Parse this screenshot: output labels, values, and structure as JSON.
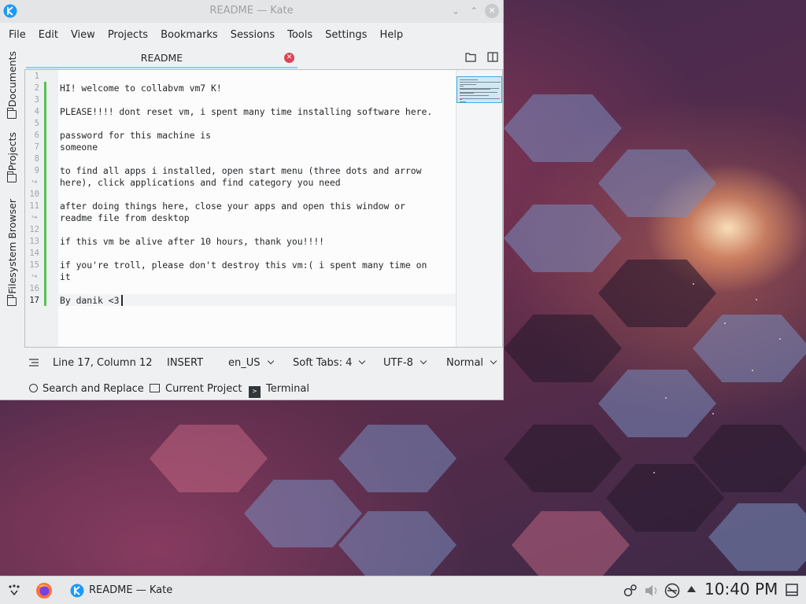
{
  "window": {
    "title": "README — Kate",
    "icon": "kate-icon",
    "controls": [
      "minimize-icon",
      "maximize-icon",
      "close-icon"
    ]
  },
  "menu": [
    "File",
    "Edit",
    "View",
    "Projects",
    "Bookmarks",
    "Sessions",
    "Tools",
    "Settings",
    "Help"
  ],
  "sidebar": {
    "tabs": [
      {
        "label": "Documents",
        "icon": "folder-icon"
      },
      {
        "label": "Projects",
        "icon": "project-icon"
      },
      {
        "label": "Filesystem Browser",
        "icon": "folder-icon"
      }
    ]
  },
  "tab": {
    "label": "README",
    "close_icon": "close-tab-icon"
  },
  "editor": {
    "lines": [
      {
        "num": "1",
        "text": ""
      },
      {
        "num": "2",
        "text": "HI! welcome to collabvm vm7 K!"
      },
      {
        "num": "3",
        "text": ""
      },
      {
        "num": "4",
        "text": "PLEASE!!!! dont reset vm, i spent many time installing software here."
      },
      {
        "num": "5",
        "text": ""
      },
      {
        "num": "6",
        "text": "password for this machine is"
      },
      {
        "num": "7",
        "text": "someone"
      },
      {
        "num": "8",
        "text": ""
      },
      {
        "num": "9",
        "text": "to find all apps i installed, open start menu (three dots and arrow"
      },
      {
        "num": "",
        "text": "here), click applications and find category you need",
        "wrapped": true
      },
      {
        "num": "10",
        "text": ""
      },
      {
        "num": "11",
        "text": "after doing things here, close your apps and open this window or"
      },
      {
        "num": "",
        "text": "readme file from desktop",
        "wrapped": true
      },
      {
        "num": "12",
        "text": ""
      },
      {
        "num": "13",
        "text": "if this vm be alive after 10 hours, thank you!!!!"
      },
      {
        "num": "14",
        "text": ""
      },
      {
        "num": "15",
        "text": "if you're troll, please don't destroy this vm:( i spent many time on"
      },
      {
        "num": "",
        "text": "it",
        "wrapped": true
      },
      {
        "num": "16",
        "text": ""
      },
      {
        "num": "17",
        "text": "By danik <3",
        "current": true
      }
    ]
  },
  "status": {
    "position": "Line 17, Column 12",
    "mode": "INSERT",
    "language": "en_US",
    "indent": "Soft Tabs: 4",
    "encoding": "UTF-8",
    "syntax": "Normal"
  },
  "bottom_tools": [
    {
      "label": "Search and Replace",
      "icon": "search-icon"
    },
    {
      "label": "Current Project",
      "icon": "project-icon"
    },
    {
      "label": "Terminal",
      "icon": "terminal-icon"
    }
  ],
  "taskbar": {
    "task_label": "README — Kate",
    "clock": "10:40 PM"
  }
}
